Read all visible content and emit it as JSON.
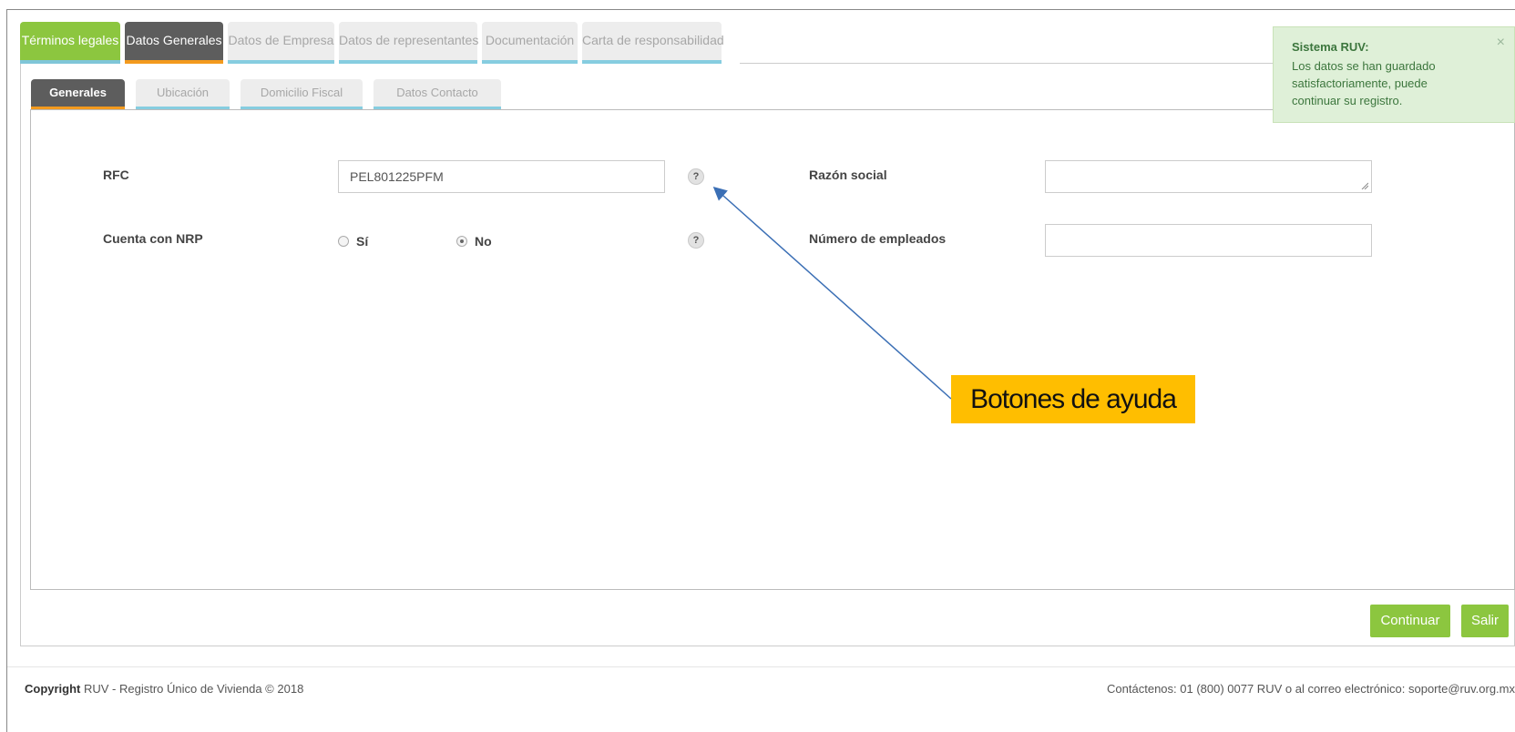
{
  "top_tabs": [
    {
      "label": "Términos legales"
    },
    {
      "label": "Datos Generales"
    },
    {
      "label": "Datos de Empresa"
    },
    {
      "label": "Datos de representantes"
    },
    {
      "label": "Documentación"
    },
    {
      "label": "Carta de responsabilidad"
    }
  ],
  "sub_tabs": [
    {
      "label": "Generales"
    },
    {
      "label": "Ubicación"
    },
    {
      "label": "Domicilio Fiscal"
    },
    {
      "label": "Datos Contacto"
    }
  ],
  "form": {
    "rfc_label": "RFC",
    "rfc_value": "PEL801225PFM",
    "razon_social_label": "Razón social",
    "razon_social_value": "",
    "nrp_label": "Cuenta con NRP",
    "nrp_options": [
      {
        "label": "Sí",
        "checked": false
      },
      {
        "label": "No",
        "checked": true
      }
    ],
    "empleados_label": "Número de empleados",
    "empleados_value": "",
    "help_glyph": "?"
  },
  "callout": {
    "text": "Botones de ayuda"
  },
  "toast": {
    "title": "Sistema RUV:",
    "message": "Los datos se han guardado satisfactoriamente, puede continuar su registro.",
    "close": "×"
  },
  "buttons": {
    "continue": "Continuar",
    "exit": "Salir"
  },
  "footer": {
    "copyright_bold": "Copyright",
    "copyright_text": " RUV - Registro Único de Vivienda © 2018",
    "contact": "Contáctenos: 01 (800) 0077 RUV o al correo electrónico: soporte@ruv.org.mx"
  },
  "colors": {
    "green": "#8cc63f",
    "dark_tab": "#5d5d5d",
    "orange_accent": "#f39a1e",
    "blue_accent": "#86cde0",
    "callout": "#ffbe00",
    "arrow": "#3b6fb5"
  }
}
